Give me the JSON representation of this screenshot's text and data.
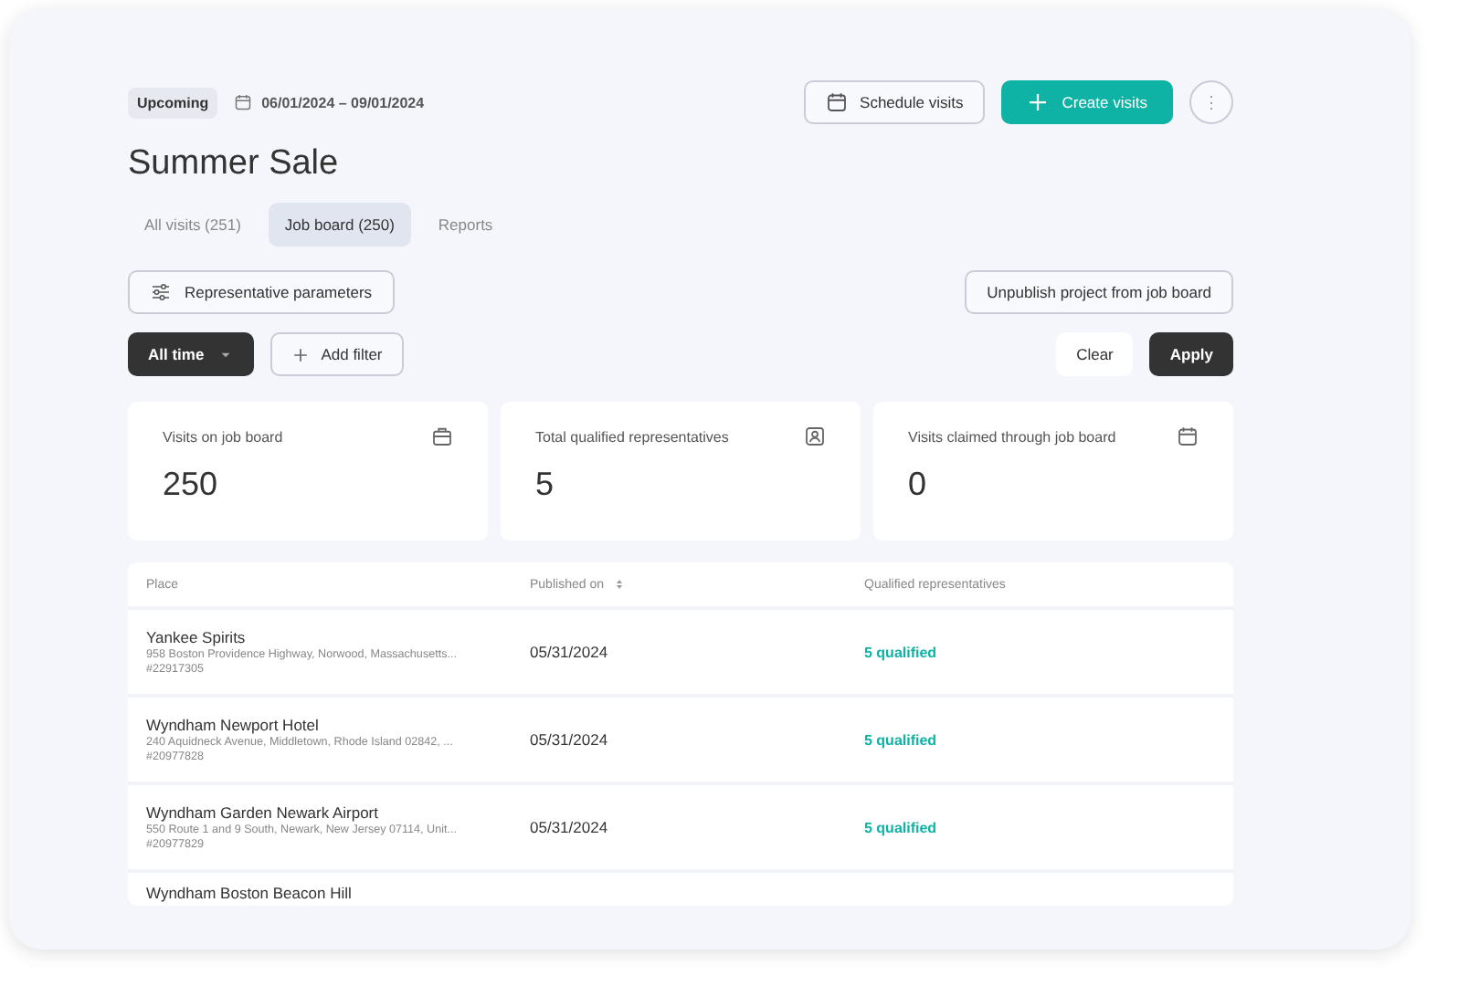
{
  "header": {
    "status_badge": "Upcoming",
    "date_range": "06/01/2024 – 09/01/2024",
    "actions": [
      {
        "kind": "outline",
        "label": "Schedule visits"
      },
      {
        "kind": "primary",
        "label": "Create visits"
      }
    ],
    "more_button": "⋮"
  },
  "title": "Summer Sale",
  "tabs": [
    {
      "label": "All visits (251)",
      "selected": false
    },
    {
      "label": "Job board (250)",
      "selected": true
    },
    {
      "label": "Reports",
      "selected": false
    }
  ],
  "parameters_button": "Representative parameters",
  "unpublish_button": "Unpublish project from job board",
  "filters": {
    "time_dropdown": "All time",
    "add_filter": "Add filter",
    "clear": "Clear",
    "apply": "Apply"
  },
  "stats": [
    {
      "label": "Visits on job board",
      "value": "250"
    },
    {
      "label": "Total qualified representatives",
      "value": "5"
    },
    {
      "label": "Visits claimed through job board",
      "value": "0"
    }
  ],
  "table": {
    "columns": [
      {
        "label": "Place",
        "sortable": false
      },
      {
        "label": "Published on",
        "sortable": true
      },
      {
        "label": "Qualified representatives",
        "sortable": false
      }
    ],
    "rows": [
      {
        "name": "Yankee Spirits",
        "address": "958 Boston Providence Highway, Norwood, Massachusetts...",
        "id": "#22917305",
        "published": "05/31/2024",
        "qualified": "5 qualified"
      },
      {
        "name": "Wyndham Newport Hotel",
        "address": "240 Aquidneck Avenue, Middletown, Rhode Island 02842, ...",
        "id": "#20977828",
        "published": "05/31/2024",
        "qualified": "5 qualified"
      },
      {
        "name": "Wyndham Garden Newark Airport",
        "address": "550 Route 1 and 9 South, Newark, New Jersey 07114, Unit...",
        "id": "#20977829",
        "published": "05/31/2024",
        "qualified": "5 qualified"
      },
      {
        "name": "Wyndham Boston Beacon Hill"
      }
    ]
  }
}
